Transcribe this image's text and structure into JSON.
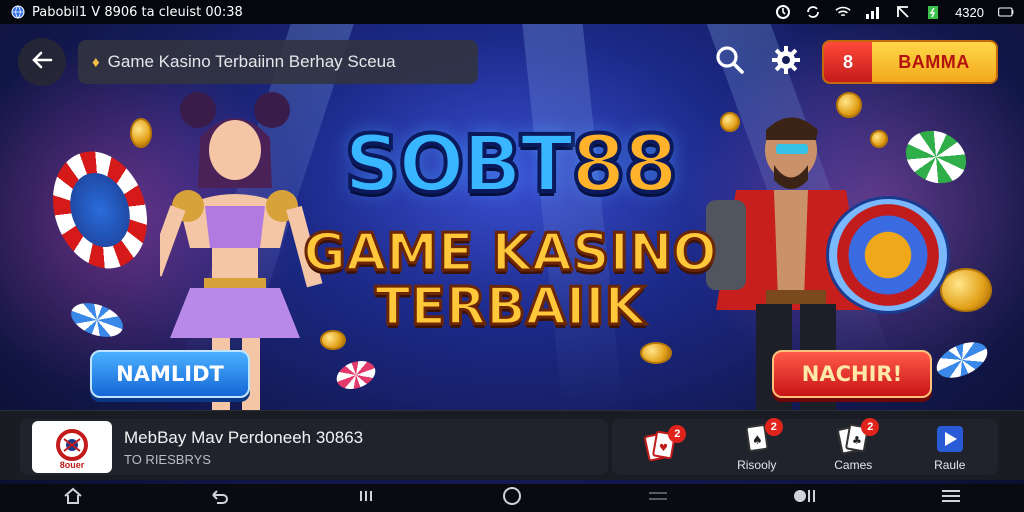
{
  "statusbar": {
    "app_title": "Pabobil1 V 8906 ta cleuist 00:38",
    "time": "4320"
  },
  "topbar": {
    "address_text": "Game Kasino Terbaiinn Berhay Sceua",
    "cta_badge": "8",
    "cta_label": "BAMMA"
  },
  "hero": {
    "title_part1": "SOBT",
    "title_part2": "88",
    "subtitle_line1": "GAME KASINO",
    "subtitle_line2": "TERBAIIK",
    "left_button": "NAMLIDT",
    "right_button": "NACHIR!"
  },
  "app_strip": {
    "logo_text": "8ouer",
    "app_name": "MebBay Mav Perdoneeh 30863",
    "app_sub": "TO RIESBRYS",
    "tabs": [
      {
        "label": "",
        "badge": "2",
        "icon": "cards-icon"
      },
      {
        "label": "Risooly",
        "badge": "2",
        "icon": "cards-icon"
      },
      {
        "label": "Cames",
        "badge": "2",
        "icon": "cards-icon"
      },
      {
        "label": "Raule",
        "badge": "",
        "icon": "play-icon"
      }
    ]
  },
  "colors": {
    "accent_blue": "#38b6ff",
    "accent_gold": "#ffc83a",
    "cta_red": "#c51b1b"
  }
}
